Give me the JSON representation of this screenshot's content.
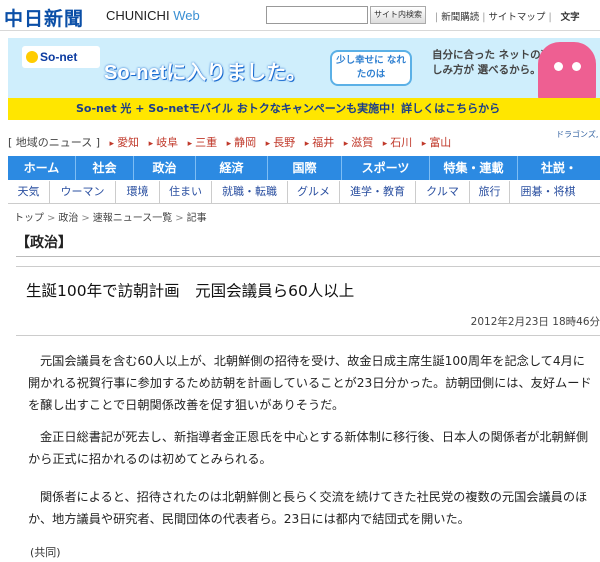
{
  "header": {
    "logo": "中日新聞",
    "logo_en": "CHUNICHI",
    "logo_web": "Web",
    "search_button": "サイト内検索",
    "links": [
      "新聞購読",
      "サイトマップ"
    ],
    "text_size_label": "文字"
  },
  "banner": {
    "logo_text": "So-net",
    "main_text": "So-netに入りました。",
    "bubble_text": "少し幸せに なれたのは",
    "side_text": "自分に合った ネットの楽しみ方が 選べるから。",
    "bar_text": "So-net 光 + So-netモバイル  おトクなキャンペーンも実施中！詳しくはこちらから"
  },
  "region_nav": {
    "label": "[ 地域のニュース ]",
    "items": [
      "愛知",
      "岐阜",
      "三重",
      "静岡",
      "長野",
      "福井",
      "滋賀",
      "石川",
      "富山"
    ],
    "more": "ドラゴンズ, グラ"
  },
  "main_nav": [
    "ホーム",
    "社会",
    "政治",
    "経済",
    "国際",
    "スポーツ",
    "特集・連載",
    "社説・"
  ],
  "sub_nav": [
    "天気",
    "ウーマン",
    "環境",
    "住まい",
    "就職・転職",
    "グルメ",
    "進学・教育",
    "クルマ",
    "旅行",
    "囲碁・将棋"
  ],
  "breadcrumb": [
    "トップ",
    "政治",
    "速報ニュース一覧",
    "記事"
  ],
  "section_title": "【政治】",
  "article": {
    "headline": "生誕100年で訪朝計画　元国会議員ら60人以上",
    "date": "2012年2月23日 18時46分",
    "paragraphs": [
      "元国会議員を含む60人以上が、北朝鮮側の招待を受け、故金日成主席生誕100周年を記念して4月に開かれる祝賀行事に参加するため訪朝を計画していることが23日分かった。訪朝団側には、友好ムードを醸し出すことで日朝関係改善を促す狙いがありそうだ。",
      "金正日総書記が死去し、新指導者金正恩氏を中心とする新体制に移行後、日本人の関係者が北朝鮮側から正式に招かれるのは初めてとみられる。",
      "関係者によると、招待されたのは北朝鮮側と長らく交流を続けてきた社民党の複数の元国会議員のほか、地方議員や研究者、民間団体の代表者ら。23日には都内で結団式を開いた。"
    ],
    "credit": "(共同)"
  }
}
